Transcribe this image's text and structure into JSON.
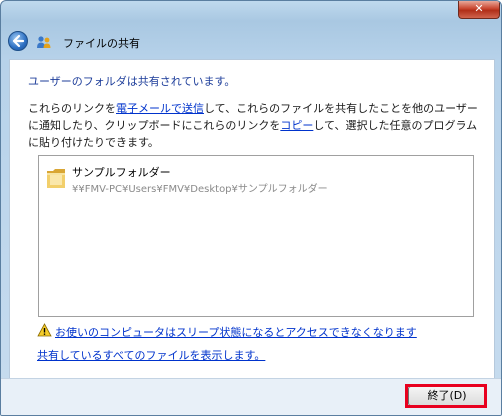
{
  "window": {
    "title": "ファイルの共有",
    "close_glyph": "✕"
  },
  "main": {
    "headline": "ユーザーのフォルダは共有されています。",
    "desc_part1": "これらのリンクを",
    "email_link": "電子メールで送信",
    "desc_part2": "して、これらのファイルを共有したことを他のユーザーに通知したり、クリップボードにこれらのリンクを",
    "copy_link": "コピー",
    "desc_part3": "して、選択した任意のプログラムに貼り付けたりできます。",
    "shared_items": [
      {
        "name": "サンプルフォルダー",
        "path": "¥¥FMV-PC¥Users¥FMV¥Desktop¥サンプルフォルダー",
        "icon": "folder-icon"
      }
    ],
    "sleep_warning_link": "お使いのコンピュータはスリープ状態になるとアクセスできなくなります",
    "show_all_link": "共有しているすべてのファイルを表示します。"
  },
  "footer": {
    "finish_label": "終了(D)"
  },
  "colors": {
    "link": "#0033cc",
    "headline": "#1d3d9a",
    "highlight": "#e8001f"
  }
}
